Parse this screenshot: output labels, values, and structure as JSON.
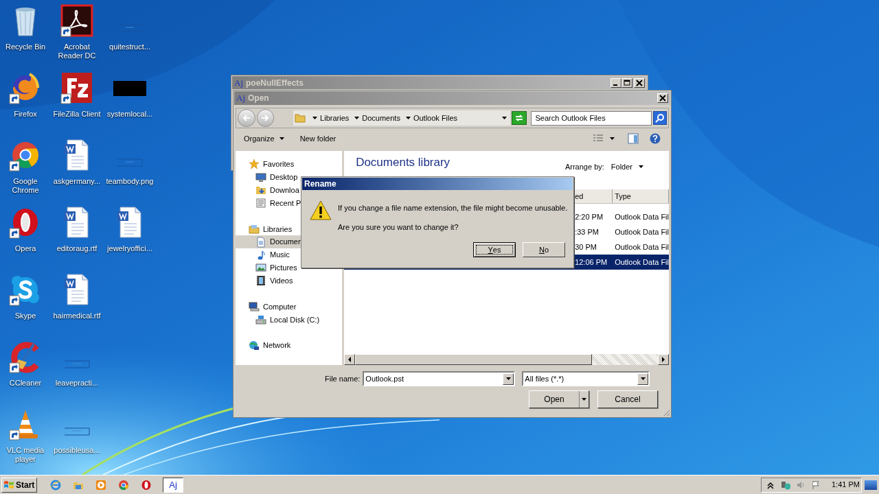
{
  "desktop_icons": [
    {
      "label": "Recycle Bin",
      "kind": "recycle",
      "shortcut": false
    },
    {
      "label": "Firefox",
      "kind": "firefox",
      "shortcut": true
    },
    {
      "label": "Google Chrome",
      "kind": "chrome",
      "shortcut": true
    },
    {
      "label": "Opera",
      "kind": "opera",
      "shortcut": true
    },
    {
      "label": "Skype",
      "kind": "skype",
      "shortcut": true
    },
    {
      "label": "CCleaner",
      "kind": "ccleaner",
      "shortcut": true
    },
    {
      "label": "VLC media player",
      "kind": "vlc",
      "shortcut": true
    },
    {
      "label": "Acrobat Reader DC",
      "kind": "acrobat",
      "shortcut": true
    },
    {
      "label": "FileZilla Client",
      "kind": "filezilla",
      "shortcut": true
    },
    {
      "label": "askgermany...",
      "kind": "word",
      "shortcut": false
    },
    {
      "label": "editoraug.rtf",
      "kind": "word",
      "shortcut": false
    },
    {
      "label": "hairmedical.rtf",
      "kind": "word",
      "shortcut": false
    },
    {
      "label": "leavepracti...",
      "kind": "blank",
      "shortcut": false
    },
    {
      "label": "possibleusa...",
      "kind": "blank",
      "shortcut": false
    },
    {
      "label": "quitestruct...",
      "kind": "blank",
      "shortcut": false
    },
    {
      "label": "systemlocal...",
      "kind": "black",
      "shortcut": false
    },
    {
      "label": "teambody.png",
      "kind": "blank",
      "shortcut": false
    },
    {
      "label": "jewelryoffici...",
      "kind": "word",
      "shortcut": false
    }
  ],
  "back_window": {
    "app_mark": "Aj",
    "title": "poeNullEffects"
  },
  "open_dialog": {
    "app_mark": "Aj",
    "title": "Open",
    "breadcrumb": [
      "Libraries",
      "Documents",
      "Outlook Files"
    ],
    "search": {
      "placeholder": "Search Outlook Files"
    },
    "toolbar": [
      {
        "label": "Organize",
        "dropdown": true
      },
      {
        "label": "New folder",
        "dropdown": false
      }
    ],
    "navigation": [
      {
        "label": "Favorites",
        "selected": false,
        "children": [
          {
            "label": "Desktop",
            "selected": false
          },
          {
            "label": "Downloa",
            "selected": false
          },
          {
            "label": "Recent P",
            "selected": false
          }
        ]
      },
      {
        "label": "Libraries",
        "selected": false,
        "children": [
          {
            "label": "Documen",
            "selected": true
          },
          {
            "label": "Music",
            "selected": false
          },
          {
            "label": "Pictures",
            "selected": false
          },
          {
            "label": "Videos",
            "selected": false
          }
        ]
      },
      {
        "label": "Computer",
        "selected": false,
        "children": [
          {
            "label": "Local Disk (C:)",
            "selected": false
          }
        ]
      },
      {
        "label": "Network",
        "selected": false
      }
    ],
    "library": {
      "title": "Documents library",
      "arrange_label": "Arrange by:",
      "arrange_value": "Folder"
    },
    "file_list": {
      "columns": [
        "ed",
        "Type"
      ],
      "rows": [
        {
          "date": "2:20 PM",
          "type": "Outlook Data Fil",
          "selected": false
        },
        {
          "date": ":33 PM",
          "type": "Outlook Data Fil",
          "selected": false
        },
        {
          "date": "30 PM",
          "type": "Outlook Data Fil",
          "selected": false
        },
        {
          "date": "12:06 PM",
          "type": "Outlook Data Fil",
          "selected": true
        }
      ]
    },
    "file_name": {
      "label": "File name:",
      "value": "Outlook.pst"
    },
    "file_type": {
      "value": "All files (*.*)"
    },
    "buttons": [
      {
        "label": "Open",
        "split": true
      },
      {
        "label": "Cancel",
        "split": false
      }
    ]
  },
  "rename_dialog": {
    "title": "Rename",
    "message": "If you change a file name extension, the file might become unusable.",
    "question": "Are you sure you want to change it?",
    "buttons": [
      {
        "label": "Yes",
        "default": true
      },
      {
        "label": "No",
        "default": false
      }
    ]
  },
  "taskbar": {
    "start": "Start",
    "apps": [
      {
        "kind": "ie",
        "active": false
      },
      {
        "kind": "explorer",
        "active": false
      },
      {
        "kind": "player",
        "active": false
      },
      {
        "kind": "chrome",
        "active": false
      },
      {
        "kind": "opera",
        "active": false
      },
      {
        "kind": "aj",
        "label": "Aj",
        "active": true
      }
    ],
    "clock": "1:41 PM"
  }
}
